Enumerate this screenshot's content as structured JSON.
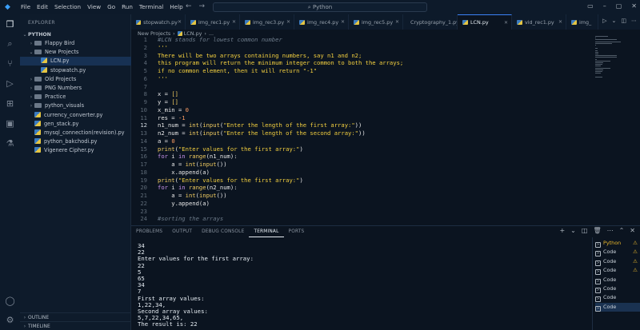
{
  "menu": [
    "File",
    "Edit",
    "Selection",
    "View",
    "Go",
    "Run",
    "Terminal",
    "Help"
  ],
  "search": {
    "placeholder": "Python"
  },
  "sidebar": {
    "title": "EXPLORER",
    "root": "PYTHON",
    "items": [
      {
        "label": "Flappy Bird",
        "kind": "folder",
        "chev": "›",
        "indent": 1
      },
      {
        "label": "New Projects",
        "kind": "folder",
        "chev": "⌄",
        "indent": 1
      },
      {
        "label": "LCN.py",
        "kind": "py",
        "chev": "",
        "indent": 2,
        "selected": true
      },
      {
        "label": "stopwatch.py",
        "kind": "py",
        "chev": "",
        "indent": 2
      },
      {
        "label": "Old Projects",
        "kind": "folder",
        "chev": "›",
        "indent": 1
      },
      {
        "label": "PNG Numbers",
        "kind": "folder",
        "chev": "›",
        "indent": 1
      },
      {
        "label": "Practice",
        "kind": "folder",
        "chev": "›",
        "indent": 1
      },
      {
        "label": "python_visuals",
        "kind": "folder",
        "chev": "›",
        "indent": 1
      },
      {
        "label": "currency_converter.py",
        "kind": "py",
        "chev": "",
        "indent": 1
      },
      {
        "label": "gen_stack.py",
        "kind": "py",
        "chev": "",
        "indent": 1
      },
      {
        "label": "mysql_connection(revision).py",
        "kind": "py",
        "chev": "",
        "indent": 1
      },
      {
        "label": "python_bakchodi.py",
        "kind": "py",
        "chev": "",
        "indent": 1
      },
      {
        "label": "Vigenere Cipher.py",
        "kind": "py",
        "chev": "",
        "indent": 1
      }
    ],
    "outline": "OUTLINE",
    "timeline": "TIMELINE"
  },
  "tabs": [
    {
      "label": "stopwatch.py",
      "active": false
    },
    {
      "label": "img_rec1.py",
      "active": false
    },
    {
      "label": "img_rec3.py",
      "active": false
    },
    {
      "label": "img_rec4.py",
      "active": false
    },
    {
      "label": "img_rec5.py",
      "active": false
    },
    {
      "label": "Cryptography_1.py",
      "active": false
    },
    {
      "label": "LCN.py",
      "active": true
    },
    {
      "label": "vid_rec1.py",
      "active": false
    },
    {
      "label": "img_",
      "active": false
    }
  ],
  "breadcrumb": [
    "New Projects",
    "LCN.py",
    "..."
  ],
  "code_lines": [
    {
      "n": "1",
      "segs": [
        [
          "c",
          "#LCN stands for lowest common number"
        ]
      ]
    },
    {
      "n": "2",
      "segs": [
        [
          "s",
          "'''"
        ]
      ]
    },
    {
      "n": "3",
      "segs": [
        [
          "s",
          "There will be two arrays containing numbers, say n1 and n2;"
        ]
      ]
    },
    {
      "n": "4",
      "segs": [
        [
          "s",
          "this program will return the minimum integer common to both the arrays;"
        ]
      ]
    },
    {
      "n": "5",
      "segs": [
        [
          "s",
          "if no common element, then it will return \"-1\""
        ]
      ]
    },
    {
      "n": "6",
      "segs": [
        [
          "s",
          "'''"
        ]
      ]
    },
    {
      "n": "7",
      "segs": []
    },
    {
      "n": "8",
      "segs": [
        [
          "t",
          "x = "
        ],
        [
          "b",
          "[]"
        ]
      ]
    },
    {
      "n": "9",
      "segs": [
        [
          "t",
          "y = "
        ],
        [
          "b",
          "[]"
        ]
      ]
    },
    {
      "n": "10",
      "segs": [
        [
          "t",
          "x_min = "
        ],
        [
          "n",
          "0"
        ]
      ]
    },
    {
      "n": "11",
      "segs": [
        [
          "t",
          "res = "
        ],
        [
          "n",
          "-1"
        ]
      ]
    },
    {
      "n": "12",
      "cur": true,
      "segs": [
        [
          "t",
          "n1_num = "
        ],
        [
          "b",
          "int"
        ],
        [
          "t",
          "("
        ],
        [
          "b",
          "input"
        ],
        [
          "t",
          "("
        ],
        [
          "s",
          "\"Enter the length of the first array:\""
        ],
        [
          "t",
          "))"
        ]
      ]
    },
    {
      "n": "13",
      "segs": [
        [
          "t",
          "n2_num = "
        ],
        [
          "b",
          "int"
        ],
        [
          "t",
          "("
        ],
        [
          "b",
          "input"
        ],
        [
          "t",
          "("
        ],
        [
          "s",
          "\"Enter the length of the second array:\""
        ],
        [
          "t",
          "))"
        ]
      ]
    },
    {
      "n": "14",
      "segs": [
        [
          "t",
          "a = "
        ],
        [
          "n",
          "0"
        ]
      ]
    },
    {
      "n": "15",
      "segs": [
        [
          "b",
          "print"
        ],
        [
          "t",
          "("
        ],
        [
          "s",
          "\"Enter values for the first array:\""
        ],
        [
          "t",
          ")"
        ]
      ]
    },
    {
      "n": "16",
      "segs": [
        [
          "k",
          "for"
        ],
        [
          "t",
          " i "
        ],
        [
          "k",
          "in"
        ],
        [
          "t",
          " "
        ],
        [
          "b",
          "range"
        ],
        [
          "t",
          "(n1_num):"
        ]
      ]
    },
    {
      "n": "17",
      "segs": [
        [
          "t",
          "    a = "
        ],
        [
          "b",
          "int"
        ],
        [
          "t",
          "("
        ],
        [
          "b",
          "input"
        ],
        [
          "t",
          "())"
        ]
      ]
    },
    {
      "n": "18",
      "segs": [
        [
          "t",
          "    x.append(a)"
        ]
      ]
    },
    {
      "n": "19",
      "segs": [
        [
          "b",
          "print"
        ],
        [
          "t",
          "("
        ],
        [
          "s",
          "\"Enter values for the first array:\""
        ],
        [
          "t",
          ")"
        ]
      ]
    },
    {
      "n": "20",
      "segs": [
        [
          "k",
          "for"
        ],
        [
          "t",
          " i "
        ],
        [
          "k",
          "in"
        ],
        [
          "t",
          " "
        ],
        [
          "b",
          "range"
        ],
        [
          "t",
          "(n2_num):"
        ]
      ]
    },
    {
      "n": "21",
      "segs": [
        [
          "t",
          "    a = "
        ],
        [
          "b",
          "int"
        ],
        [
          "t",
          "("
        ],
        [
          "b",
          "input"
        ],
        [
          "t",
          "())"
        ]
      ]
    },
    {
      "n": "22",
      "segs": [
        [
          "t",
          "    y.append(a)"
        ]
      ]
    },
    {
      "n": "23",
      "segs": []
    },
    {
      "n": "24",
      "segs": [
        [
          "c",
          "#sorting the arrays"
        ]
      ]
    }
  ],
  "panel": {
    "tabs": [
      {
        "label": "PROBLEMS",
        "active": false
      },
      {
        "label": "OUTPUT",
        "active": false
      },
      {
        "label": "DEBUG CONSOLE",
        "active": false
      },
      {
        "label": "TERMINAL",
        "active": true
      },
      {
        "label": "PORTS",
        "active": false
      }
    ],
    "terminal_lines": [
      "34",
      "22",
      "Enter values for the first array:",
      "22",
      "5",
      "65",
      "34",
      "7",
      "First array values:",
      "1,22,34,",
      "Second array values:",
      "5,7,22,34,65,",
      "The result is: 22"
    ],
    "terminals": [
      {
        "label": "Python",
        "warn": true,
        "active": false
      },
      {
        "label": "Code",
        "warn": true,
        "active": false
      },
      {
        "label": "Code",
        "warn": true,
        "active": false
      },
      {
        "label": "Code",
        "warn": true,
        "active": false
      },
      {
        "label": "Code",
        "warn": false,
        "active": false
      },
      {
        "label": "Code",
        "warn": false,
        "active": false
      },
      {
        "label": "Code",
        "warn": false,
        "active": false
      },
      {
        "label": "Code",
        "warn": false,
        "active": true
      }
    ]
  },
  "colors": {
    "accent": "#3b82f6",
    "background": "#0b1420",
    "string": "#f4d03f",
    "keyword": "#c792ea",
    "warning": "#e5b52b"
  }
}
